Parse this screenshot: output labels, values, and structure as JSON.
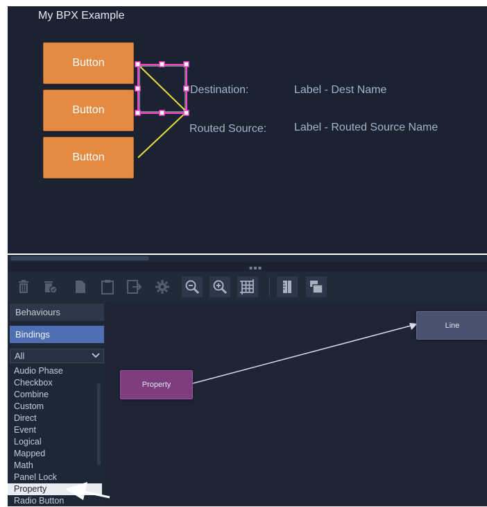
{
  "canvas": {
    "title": "My BPX Example",
    "buttons": [
      "Button",
      "Button",
      "Button"
    ],
    "labels": {
      "destination_caption": "Destination:",
      "destination_value": "Label - Dest Name",
      "routed_caption": "Routed Source:",
      "routed_value": "Label - Routed Source Name"
    }
  },
  "toolbar": {
    "icons": [
      "trash-icon",
      "delete-all-icon",
      "document-icon",
      "clipboard-icon",
      "export-icon",
      "gear-icon",
      "zoom-out-icon",
      "zoom-in-icon",
      "grid-icon",
      "ruler-icon",
      "layers-icon"
    ]
  },
  "sidebar": {
    "tabs": [
      "Behaviours",
      "Bindings"
    ],
    "filter": {
      "value": "All"
    },
    "items": [
      "Audio Phase",
      "Checkbox",
      "Combine",
      "Custom",
      "Direct",
      "Event",
      "Logical",
      "Mapped",
      "Math",
      "Panel Lock",
      "Property",
      "Radio Button"
    ],
    "selected": "Property"
  },
  "graph": {
    "nodes": {
      "property": "Property",
      "line": "Line"
    }
  },
  "colors": {
    "canvas_bg": "#1b2333",
    "button_orange": "#e48b43",
    "label_text": "#a4b4c6",
    "selection_magenta": "#ff3fd0",
    "connector_yellow": "#e8e23a",
    "bindings_tab": "#4f6fb4",
    "property_node": "#7d3d7f",
    "line_node": "#49536f"
  }
}
